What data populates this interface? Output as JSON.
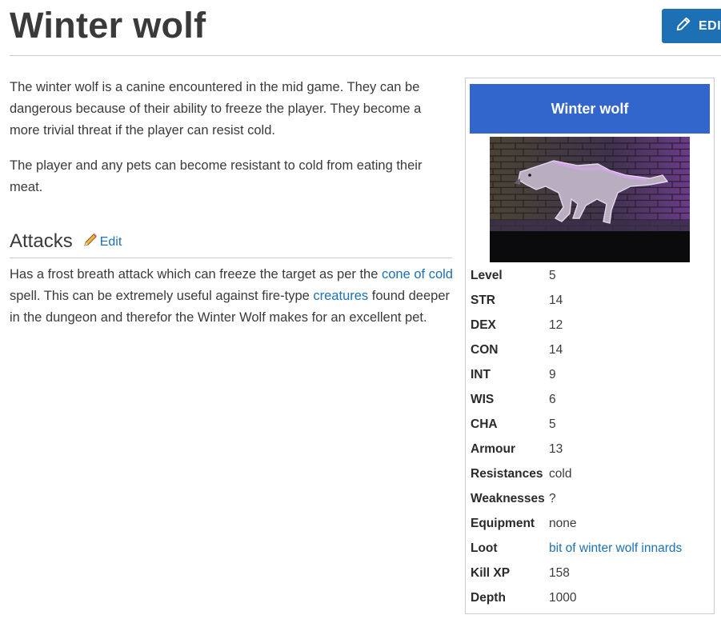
{
  "page": {
    "title": "Winter wolf",
    "edit_label": "EDIT"
  },
  "content": {
    "paragraphs": [
      "The winter wolf is a canine encountered in the mid game. They can be dangerous because of their ability to freeze the player. They become a more trivial threat if the player can resist cold.",
      "The player and any pets can become resistant to cold from eating their meat."
    ]
  },
  "attacks": {
    "heading": "Attacks",
    "edit_label": "Edit",
    "text_1": "Has a frost breath attack which can freeze the target as per the ",
    "link_1": "cone of cold",
    "text_2": " spell. This can be extremely useful against fire-type ",
    "link_2": "creatures",
    "text_3": " found deeper in the dungeon and therefor the Winter Wolf makes for an excellent pet."
  },
  "infobox": {
    "title": "Winter wolf",
    "stats": [
      {
        "label": "Level",
        "value": "5"
      },
      {
        "label": "STR",
        "value": "14"
      },
      {
        "label": "DEX",
        "value": "12"
      },
      {
        "label": "CON",
        "value": "14"
      },
      {
        "label": "INT",
        "value": "9"
      },
      {
        "label": "WIS",
        "value": "6"
      },
      {
        "label": "CHA",
        "value": "5"
      },
      {
        "label": "Armour",
        "value": "13"
      },
      {
        "label": "Resistances",
        "value": "cold"
      },
      {
        "label": "Weaknesses",
        "value": "?"
      },
      {
        "label": "Equipment",
        "value": "none"
      },
      {
        "label": "Loot",
        "value": "bit of winter wolf innards",
        "is_link": true
      },
      {
        "label": "Kill XP",
        "value": "158"
      },
      {
        "label": "Depth",
        "value": "1000"
      }
    ]
  },
  "colors": {
    "link": "#1c70b3",
    "edit_button": "#1c70b3",
    "infobox_header": "#3366cc",
    "text": "#3a3a3a"
  }
}
